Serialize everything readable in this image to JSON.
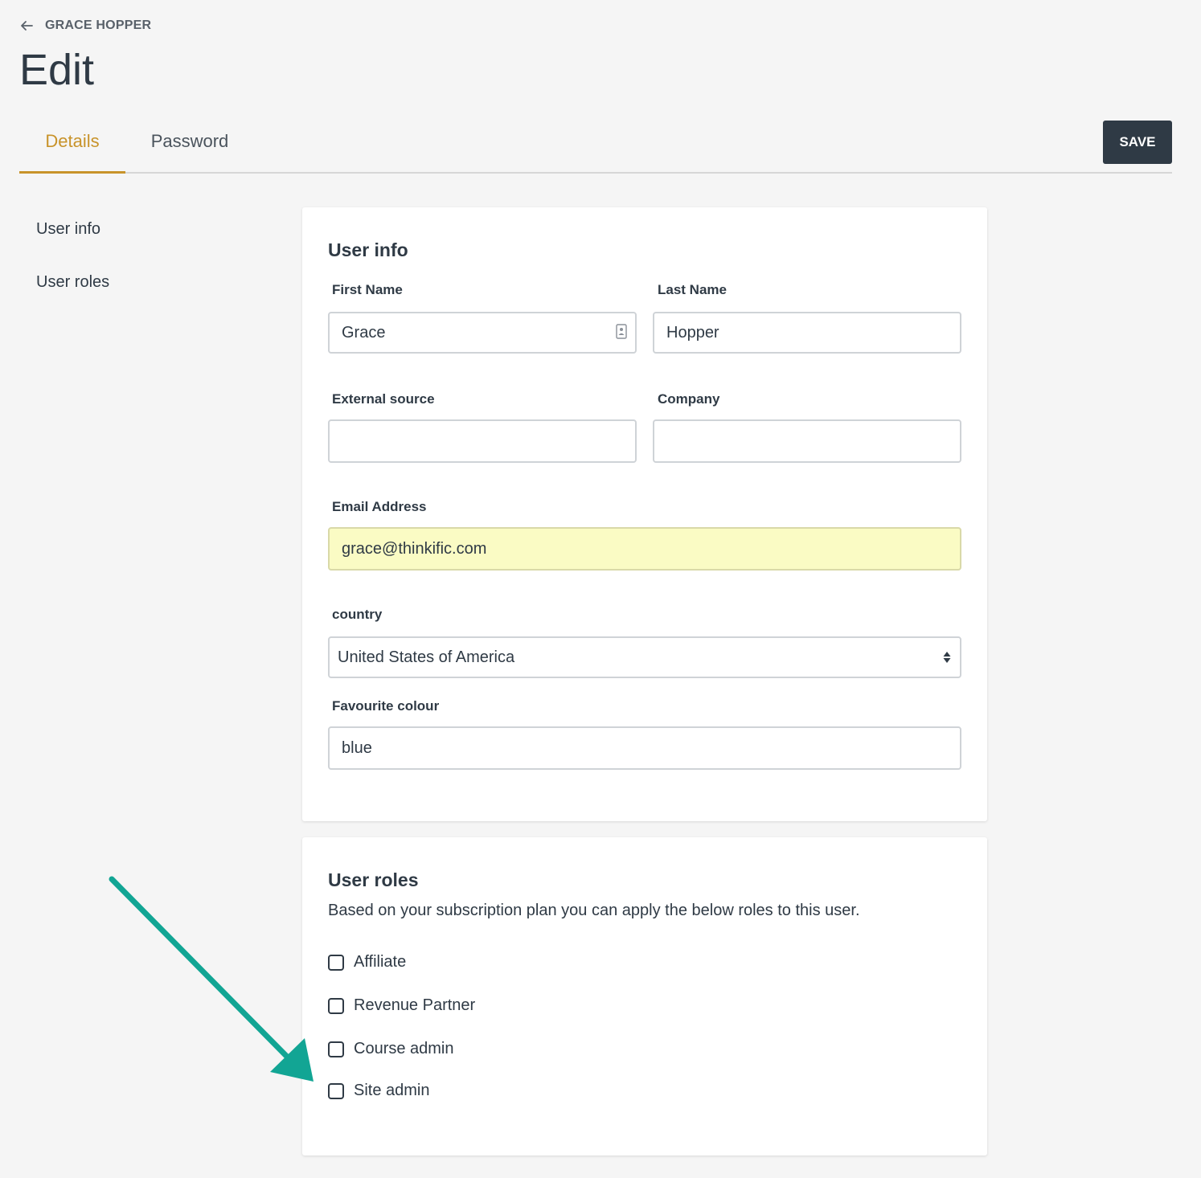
{
  "header": {
    "back_label": "GRACE HOPPER",
    "title": "Edit",
    "save_label": "SAVE"
  },
  "tabs": [
    {
      "label": "Details",
      "active": true
    },
    {
      "label": "Password",
      "active": false
    }
  ],
  "side_nav": {
    "items": [
      {
        "label": "User info"
      },
      {
        "label": "User roles"
      }
    ]
  },
  "user_info": {
    "title": "User info",
    "first_name": {
      "label": "First Name",
      "value": "Grace"
    },
    "last_name": {
      "label": "Last Name",
      "value": "Hopper"
    },
    "external_source": {
      "label": "External source",
      "value": ""
    },
    "company": {
      "label": "Company",
      "value": ""
    },
    "email": {
      "label": "Email Address",
      "value": "grace@thinkific.com"
    },
    "country": {
      "label": "country",
      "selected": "United States of America"
    },
    "favourite_colour": {
      "label": "Favourite colour",
      "value": "blue"
    }
  },
  "user_roles": {
    "title": "User roles",
    "description": "Based on your subscription plan you can apply the below roles to this user.",
    "roles": [
      {
        "label": "Affiliate",
        "checked": false
      },
      {
        "label": "Revenue Partner",
        "checked": false
      },
      {
        "label": "Course admin",
        "checked": false
      },
      {
        "label": "Site admin",
        "checked": false
      }
    ]
  },
  "colors": {
    "accent": "#c8932a",
    "dark": "#2f3a45",
    "annotation": "#12a594",
    "autofill": "#fafbc4"
  }
}
